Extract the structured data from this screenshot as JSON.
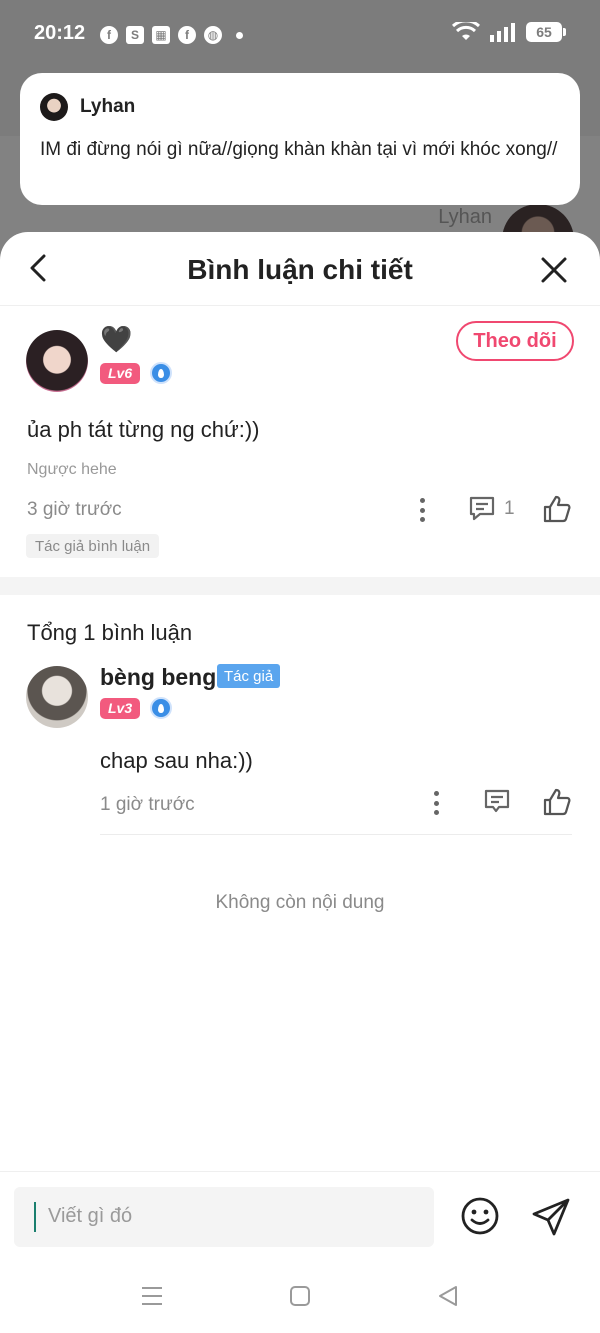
{
  "status_bar": {
    "time": "20:12",
    "battery": "65"
  },
  "notification": {
    "sender": "Lyhan",
    "message": "IM đi đừng nói gì nữa//giọng khàn khàn tại vì mới khóc xong//"
  },
  "background_chat": {
    "name": "Lyhan"
  },
  "header": {
    "title": "Bình luận chi tiết"
  },
  "main_comment": {
    "username_emoji": "🖤",
    "level": "Lv6",
    "follow_label": "Theo dõi",
    "text": "ủa ph tát từng ng chứ:))",
    "subtext": "Ngược hehe",
    "time": "3 giờ trước",
    "reply_count": "1",
    "tag": "Tác giả bình luận"
  },
  "replies": {
    "total_label": "Tổng 1 bình luận",
    "items": [
      {
        "username": "bèng beng",
        "badge": "Tác giả",
        "level": "Lv3",
        "text": "chap sau nha:))",
        "time": "1 giờ trước"
      }
    ],
    "end_label": "Không còn nội dung"
  },
  "input": {
    "placeholder": "Viết gì đó"
  },
  "colors": {
    "accent_pink": "#f04870",
    "level_badge": "#f25a7e",
    "author_badge": "#5aa5ee"
  }
}
